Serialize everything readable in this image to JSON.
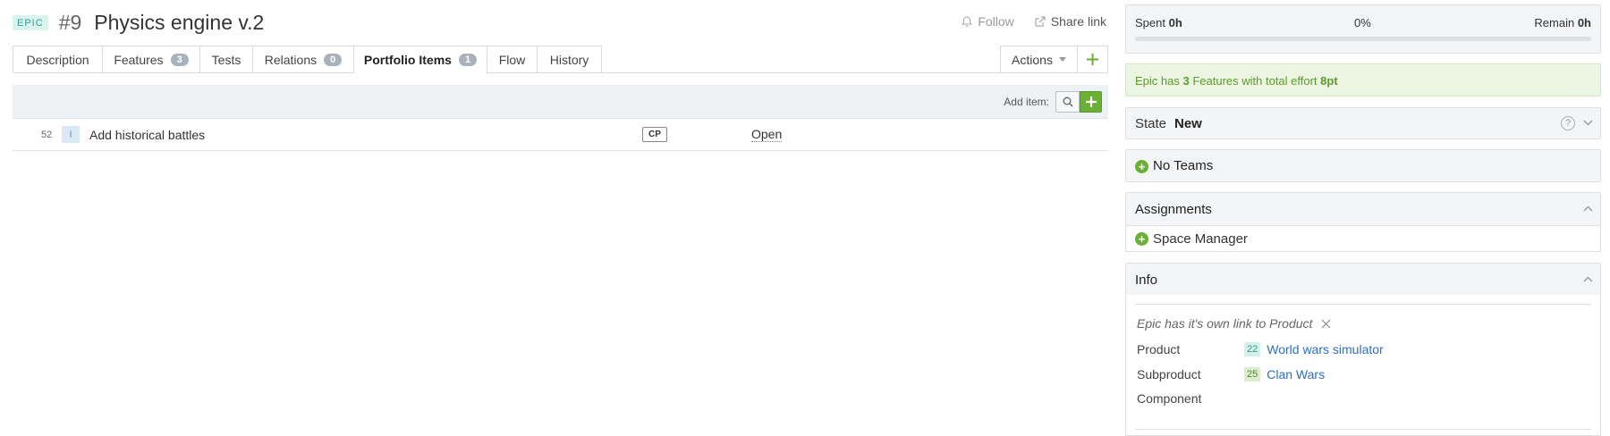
{
  "header": {
    "badge": "EPIC",
    "id": "#9",
    "title": "Physics engine v.2",
    "follow_label": "Follow",
    "share_label": "Share link"
  },
  "tabs": [
    {
      "label": "Description"
    },
    {
      "label": "Features",
      "count": "3"
    },
    {
      "label": "Tests"
    },
    {
      "label": "Relations",
      "count": "0"
    },
    {
      "label": "Portfolio Items",
      "count": "1",
      "active": true
    },
    {
      "label": "Flow"
    },
    {
      "label": "History"
    }
  ],
  "actions_label": "Actions",
  "add_item_label": "Add item:",
  "items": [
    {
      "id": "52",
      "type": "I",
      "title": "Add historical battles",
      "badge": "CP",
      "state": "Open"
    }
  ],
  "effort": {
    "spent_label": "Spent",
    "spent_value": "0h",
    "percent": "0%",
    "remain_label": "Remain",
    "remain_value": "0h",
    "progress_fraction": 0
  },
  "notice": {
    "prefix": "Epic has ",
    "count": "3",
    "middle": " Features with total effort ",
    "effort": "8pt"
  },
  "state": {
    "label": "State",
    "value": "New",
    "help": "?"
  },
  "teams_label": "No Teams",
  "assignments": {
    "title": "Assignments",
    "role": "Space Manager"
  },
  "info": {
    "title": "Info",
    "note": "Epic has it's own link to Product",
    "product_label": "Product",
    "product_id": "22",
    "product_name": "World wars simulator",
    "subproduct_label": "Subproduct",
    "subproduct_id": "25",
    "subproduct_name": "Clan Wars",
    "component_label": "Component"
  },
  "colors": {
    "accent_green": "#6ab034",
    "link_blue": "#2e6fbf",
    "epic_teal": "#2aa198"
  }
}
